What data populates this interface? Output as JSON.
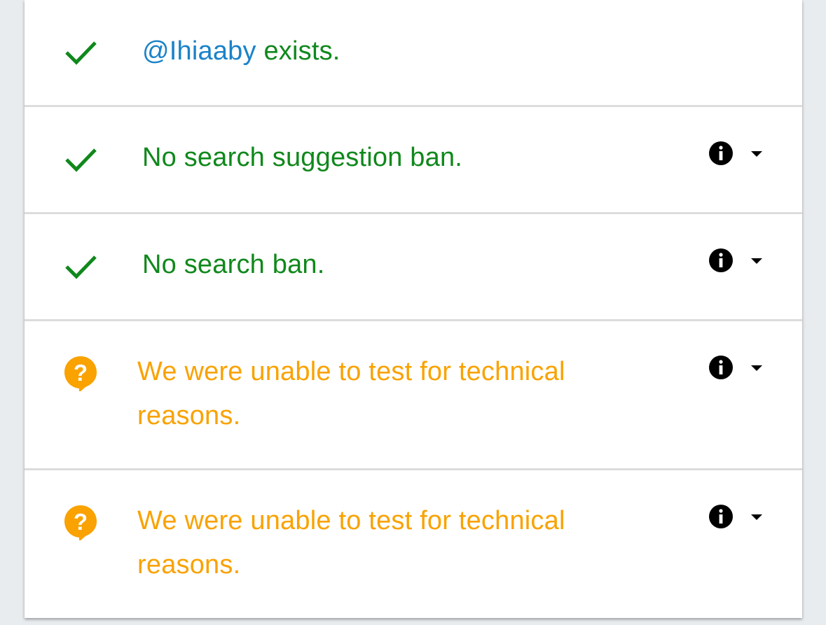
{
  "results": [
    {
      "status": "ok",
      "icon": "checkmark-icon",
      "handle": "@Ihiaaby",
      "text": " exists.",
      "has_details": false
    },
    {
      "status": "ok",
      "icon": "checkmark-icon",
      "text": "No search suggestion ban.",
      "has_details": true
    },
    {
      "status": "ok",
      "icon": "checkmark-icon",
      "text": "No search ban.",
      "has_details": true
    },
    {
      "status": "unknown",
      "icon": "question-bubble-icon",
      "text": "We were unable to test for technical reasons.",
      "has_details": true
    },
    {
      "status": "unknown",
      "icon": "question-bubble-icon",
      "text": "We were unable to test for technical reasons.",
      "has_details": true
    }
  ],
  "colors": {
    "ok": "#10881c",
    "unknown": "#f9a200",
    "handle": "#1b82c9",
    "info_icon": "#000000"
  }
}
